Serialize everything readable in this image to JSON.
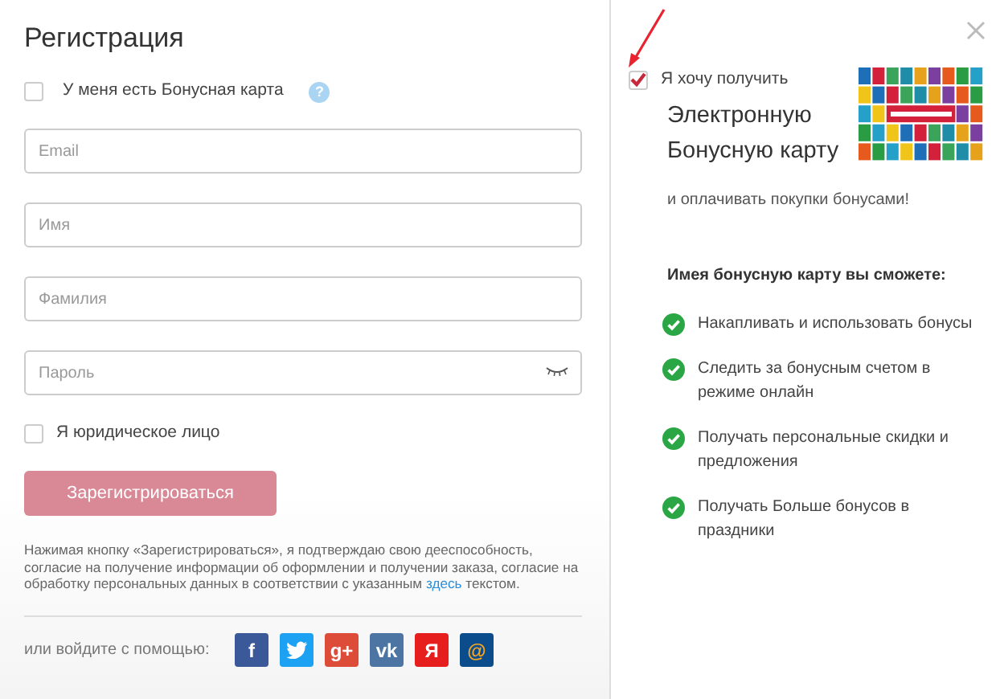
{
  "title": "Регистрация",
  "bonus_card_option": {
    "label": "У меня есть Бонусная карта",
    "checked": false,
    "help": "?"
  },
  "fields": [
    {
      "placeholder": "Email",
      "kind": "text"
    },
    {
      "placeholder": "Имя",
      "kind": "text"
    },
    {
      "placeholder": "Фамилия",
      "kind": "text"
    },
    {
      "placeholder": "Пароль",
      "kind": "password"
    }
  ],
  "legal_entity": {
    "label": "Я юридическое лицо",
    "checked": false
  },
  "register_button": {
    "label": "Зарегистрироваться",
    "disabled": true
  },
  "disclaimer": {
    "text": "Нажимая кнопку «Зарегистрироваться», я подтверждаю свою дееспособность, согласие на получение информации об оформлении и получении заказа, согласие на обработку персональных данных в соответствии с указанным",
    "link": "здесь",
    "after": "текстом."
  },
  "social": {
    "label": "или войдите с помощью:",
    "networks": [
      {
        "kind": "glyph",
        "glyph": "f",
        "color": "#3b5998"
      },
      {
        "kind": "bird",
        "color": "#1da1f2"
      },
      {
        "kind": "glyph",
        "glyph": "g+",
        "color": "#dd4b39"
      },
      {
        "kind": "glyph",
        "glyph": "vk",
        "color": "#4c75a3"
      },
      {
        "kind": "glyph",
        "glyph": "Я",
        "color": "#e61e1e"
      },
      {
        "kind": "glyph",
        "glyph": "@",
        "color": "#0b4c8c"
      }
    ]
  },
  "offer": {
    "checked": true,
    "label": "Я хочу получить",
    "title_lines": [
      "Электронную",
      "Бонусную карту"
    ],
    "subtitle": "и оплачивать покупки бонусами!"
  },
  "benefits": {
    "heading": "Имея бонусную карту вы сможете:",
    "items": [
      "Накапливать и использовать бонусы",
      "Следить за бонусным счетом в режиме онлайн",
      "Получать персональные скидки и предложения",
      "Получать Больше бонусов в праздники"
    ]
  }
}
